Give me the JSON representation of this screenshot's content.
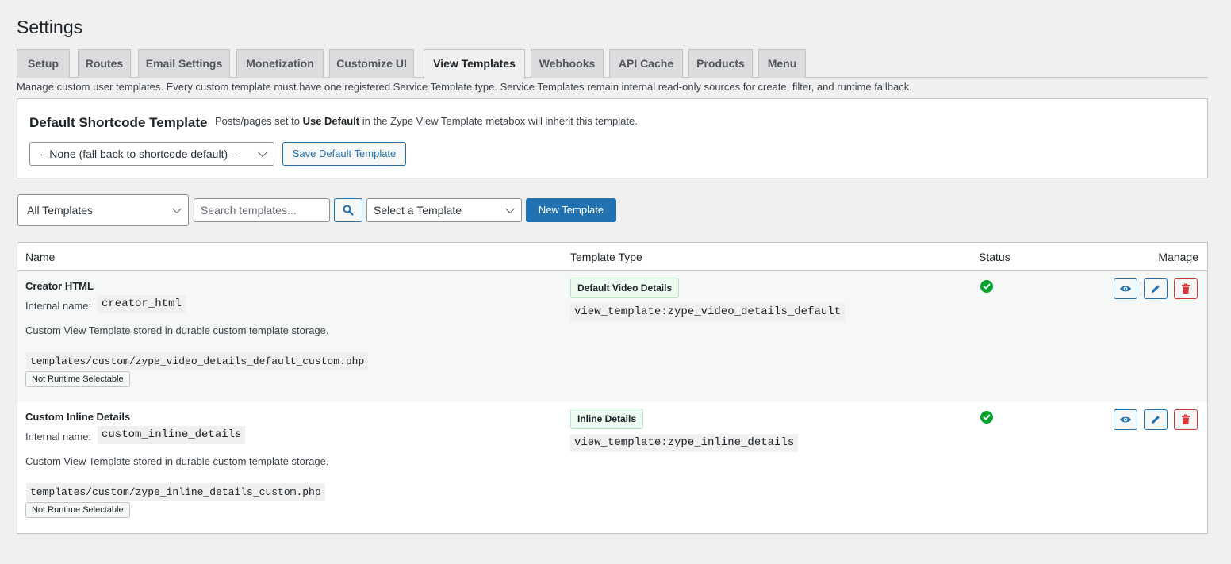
{
  "page": {
    "title": "Settings"
  },
  "tabs": [
    {
      "label": "Setup"
    },
    {
      "label": "Routes"
    },
    {
      "label": "Email Settings"
    },
    {
      "label": "Monetization"
    },
    {
      "label": "Customize UI"
    },
    {
      "label": "View Templates",
      "active": true
    },
    {
      "label": "Webhooks"
    },
    {
      "label": "API Cache"
    },
    {
      "label": "Products"
    },
    {
      "label": "Menu"
    }
  ],
  "description": "Manage custom user templates. Every custom template must have one registered Service Template type. Service Templates remain internal read-only sources for create, filter, and runtime fallback.",
  "default_card": {
    "title": "Default Shortcode Template",
    "note_prefix": "Posts/pages set to",
    "note_bold": "Use Default",
    "note_suffix": "in the Zype View Template metabox will inherit this template.",
    "select_value": "-- None (fall back to shortcode default) --",
    "save_label": "Save Default Template"
  },
  "toolbar": {
    "filter_value": "All Templates",
    "search_placeholder": "Search templates...",
    "template_select_value": "Select a Template",
    "new_label": "New Template"
  },
  "table": {
    "headers": {
      "name": "Name",
      "type": "Template Type",
      "status": "Status",
      "manage": "Manage"
    },
    "internal_label": "Internal name:",
    "rows": [
      {
        "name": "Creator HTML",
        "internal_name": "creator_html",
        "description": "Custom View Template stored in durable custom template storage.",
        "path": "templates/custom/zype_video_details_default_custom.php",
        "runtime_badge": "Not Runtime Selectable",
        "type_label": "Default Video Details",
        "type_key": "view_template:zype_video_details_default",
        "status": "active"
      },
      {
        "name": "Custom Inline Details",
        "internal_name": "custom_inline_details",
        "description": "Custom View Template stored in durable custom template storage.",
        "path": "templates/custom/zype_inline_details_custom.php",
        "runtime_badge": "Not Runtime Selectable",
        "type_label": "Inline Details",
        "type_key": "view_template:zype_inline_details",
        "status": "active"
      }
    ]
  },
  "colors": {
    "accent": "#2271b1",
    "success": "#00a32a",
    "danger": "#d63638"
  }
}
